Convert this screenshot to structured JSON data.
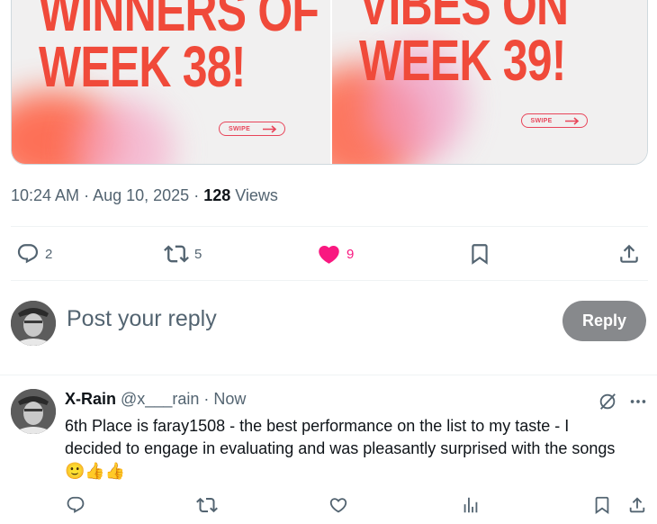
{
  "media": {
    "left_text_line1": "WINNERS OF",
    "left_text_line2": "WEEK 38!",
    "right_text_line1": "VIBES ON",
    "right_text_line2": "WEEK 39!",
    "swipe_label": "SWIPE"
  },
  "meta": {
    "time": "10:24 AM",
    "sep1": " · ",
    "date": "Aug 10, 2025",
    "sep2": " · ",
    "views_count": "128",
    "views_label": " Views"
  },
  "actions": {
    "replies": "2",
    "reposts": "5",
    "likes": "9",
    "liked": true
  },
  "composer": {
    "placeholder": "Post your reply",
    "reply_button": "Reply"
  },
  "reply": {
    "name": "X-Rain",
    "handle": "@x___rain",
    "sep": " · ",
    "time": "Now",
    "text": "6th Place is faray1508 - the best performance on the list to my taste - I decided to engage in evaluating and was pleasantly surprised with the songs",
    "emojis": "🙂👍👍"
  },
  "colors": {
    "accent_like": "#f91880",
    "text_secondary": "#536471",
    "reply_button_bg": "#87898c",
    "media_text": "#f04a3a"
  },
  "icons": [
    "reply-icon",
    "repost-icon",
    "heart-filled-icon",
    "bookmark-icon",
    "share-icon",
    "grok-icon",
    "more-icon",
    "heart-outline-icon",
    "analytics-icon"
  ]
}
